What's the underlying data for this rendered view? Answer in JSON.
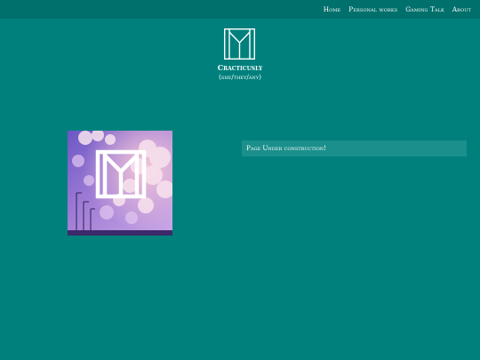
{
  "nav": {
    "items": [
      {
        "label": "Home"
      },
      {
        "label": "Personal works"
      },
      {
        "label": "Gaming Talk"
      },
      {
        "label": "About"
      }
    ]
  },
  "site": {
    "logo_icon": "monogram-logo-icon",
    "title": "Cracticusly",
    "pronouns": "(she/they/any)"
  },
  "main": {
    "hero_image": "sky-artwork-with-logo",
    "notice": "Page Under construction!"
  },
  "colors": {
    "background": "#00807c",
    "topbar": "#00706c",
    "notice_bg": "#1b8f8b",
    "text": "#ffffff"
  }
}
